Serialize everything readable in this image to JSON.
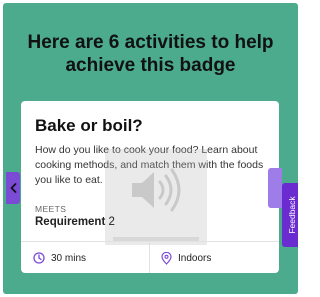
{
  "page": {
    "headline": "Here are 6 activities to help achieve this badge"
  },
  "card": {
    "title": "Bake or boil?",
    "description": "How do you like to cook your food? Learn about cooking methods, and match them with the foods you like to eat.",
    "meets_label": "MEETS",
    "requirement_label": "Requirement",
    "requirement_number": "2",
    "time": "30 mins",
    "location": "Indoors",
    "time_icon": "clock-icon",
    "location_icon": "location-pin-icon"
  },
  "media_overlay": {
    "icon": "speaker-icon"
  },
  "navigation": {
    "prev_icon": "chevron-left-icon"
  },
  "feedback": {
    "label": "Feedback"
  },
  "colors": {
    "background": "#4bab8c",
    "accent": "#7b4bd6",
    "feedback_tab": "#6a2bd0"
  }
}
